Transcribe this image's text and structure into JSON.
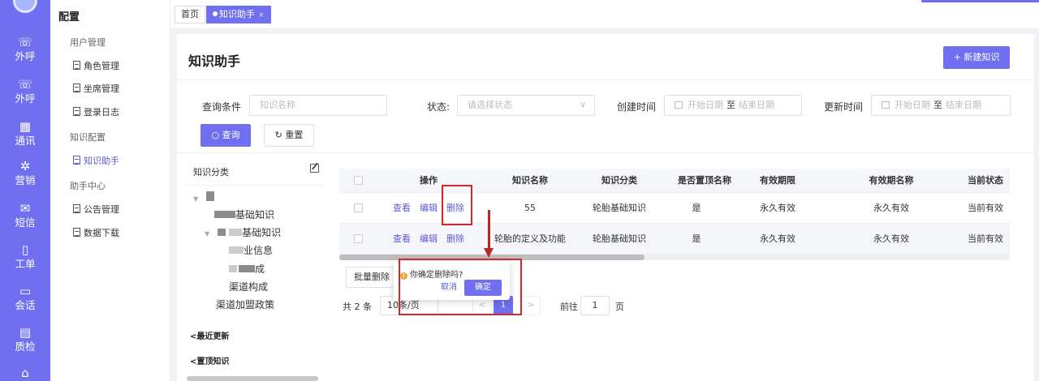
{
  "rail": {
    "items": [
      {
        "icon": "phone-out-icon",
        "label": "外呼"
      },
      {
        "icon": "phone-out-alt-icon",
        "label": "外呼"
      },
      {
        "icon": "contacts-icon",
        "label": "通讯"
      },
      {
        "icon": "marketing-icon",
        "label": "营销"
      },
      {
        "icon": "sms-icon",
        "label": "短信"
      },
      {
        "icon": "ticket-icon",
        "label": "工单"
      },
      {
        "icon": "chat-icon",
        "label": "会话"
      },
      {
        "icon": "quality-icon",
        "label": "质检"
      }
    ]
  },
  "sidebar": {
    "title": "配置",
    "groups": [
      {
        "label": "用户管理",
        "items": [
          "角色管理",
          "坐席管理",
          "登录日志"
        ]
      },
      {
        "label": "知识配置",
        "items": [
          "知识助手"
        ]
      },
      {
        "label": "助手中心",
        "items": [
          "公告管理",
          "数据下载"
        ]
      }
    ],
    "active": "知识助手"
  },
  "tabs": [
    {
      "label": "首页",
      "active": false
    },
    {
      "label": "知识助手",
      "active": true,
      "close": "×"
    }
  ],
  "page": {
    "title": "知识助手",
    "new_button": "+ 新建知识"
  },
  "filters": {
    "query_label": "查询条件",
    "name_placeholder": "知识名称",
    "status_label": "状态:",
    "status_placeholder": "请选择状态",
    "created_label": "创建时间",
    "updated_label": "更新时间",
    "start_placeholder": "开始日期",
    "range_sep": "至",
    "end_placeholder": "结束日期",
    "query_button": "查询",
    "reset_button": "重置"
  },
  "tree": {
    "header": "知识分类",
    "nodes": [
      "基础知识",
      "基础知识",
      "业信息",
      "成",
      "渠道构成",
      "渠道加盟政策"
    ],
    "recent": "最近更新",
    "pinned": "置顶知识"
  },
  "table": {
    "columns": [
      "操作",
      "知识名称",
      "知识分类",
      "是否置顶名称",
      "有效期限",
      "有效期名称",
      "当前状态"
    ],
    "actions": {
      "view": "查看",
      "edit": "编辑",
      "delete": "删除"
    },
    "rows": [
      {
        "name": "55",
        "category": "轮胎基础知识",
        "pinned": "是",
        "validity": "永久有效",
        "validity_name": "永久有效",
        "status": "当前有效"
      },
      {
        "name": "轮胎的定义及功能",
        "category": "轮胎基础知识",
        "pinned": "是",
        "validity": "永久有效",
        "validity_name": "永久有效",
        "status": "当前有效"
      }
    ],
    "batch_delete": "批量删除"
  },
  "pagination": {
    "total": "共 2 条",
    "page_size": "10条/页",
    "prev": "<",
    "current": "1",
    "next": ">",
    "goto_label": "前往",
    "goto_value": "1",
    "goto_unit": "页"
  },
  "confirm": {
    "warn_glyph": "!",
    "message": "你确定删除吗?",
    "cancel": "取消",
    "ok": "确定"
  }
}
